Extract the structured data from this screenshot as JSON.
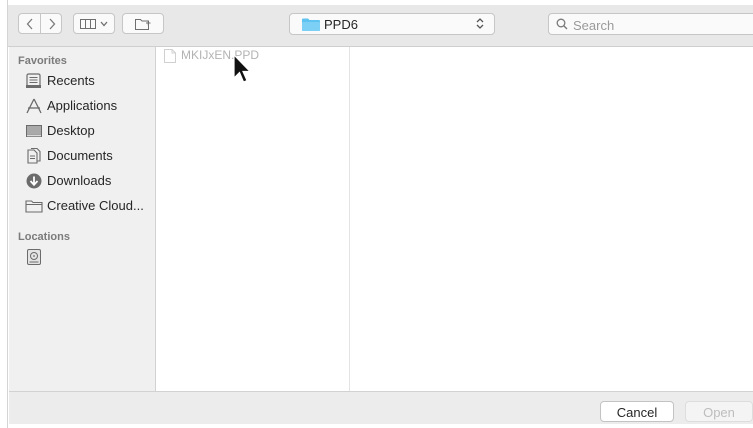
{
  "toolbar": {
    "back_icon": "chevron-left-icon",
    "forward_icon": "chevron-right-icon",
    "view_icon": "column-view-icon",
    "new_folder_icon": "new-folder-icon",
    "location": "PPD6",
    "search_placeholder": "Search"
  },
  "sidebar": {
    "favorites_header": "Favorites",
    "favorites": [
      {
        "label": "Recents",
        "icon": "recents-icon"
      },
      {
        "label": "Applications",
        "icon": "applications-icon"
      },
      {
        "label": "Desktop",
        "icon": "desktop-icon"
      },
      {
        "label": "Documents",
        "icon": "documents-icon"
      },
      {
        "label": "Downloads",
        "icon": "downloads-icon"
      },
      {
        "label": "Creative Cloud...",
        "icon": "folder-icon"
      }
    ],
    "locations_header": "Locations",
    "locations": [
      {
        "label": "",
        "icon": "hard-disk-icon"
      }
    ]
  },
  "browser": {
    "files": [
      {
        "name": "MKIJxEN.PPD",
        "enabled": false
      }
    ]
  },
  "footer": {
    "cancel_label": "Cancel",
    "open_label": "Open"
  },
  "colors": {
    "toolbar_bg": "#e8e8e8",
    "sidebar_bg": "#f0f0f0",
    "folder_blue": "#5ec3f0"
  }
}
